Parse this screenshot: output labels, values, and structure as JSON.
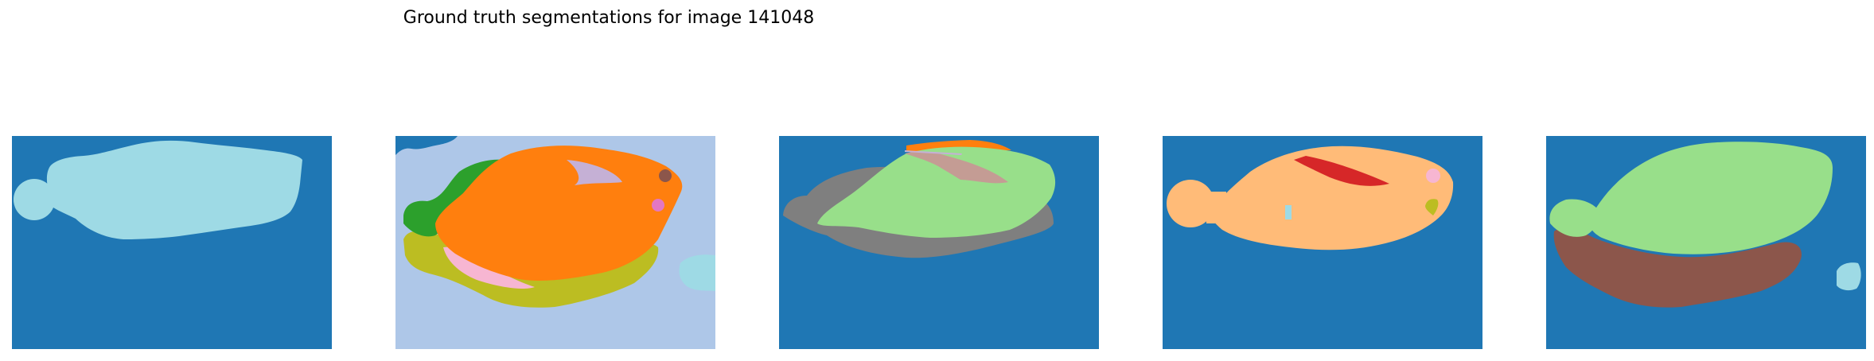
{
  "figure": {
    "title": "Ground truth segmentations for image 141048"
  },
  "panels": [
    {
      "id": 1,
      "background": "#1f77b4",
      "segments": [
        "#9edae5"
      ]
    },
    {
      "id": 2,
      "background": "#aec7e8",
      "segments": [
        "#ff7f0e",
        "#2ca02c",
        "#bcbd22",
        "#f7b6d2",
        "#c5b0d5",
        "#8c564b",
        "#e377c2",
        "#9edae5",
        "#1f77b4"
      ]
    },
    {
      "id": 3,
      "background": "#1f77b4",
      "segments": [
        "#7f7f7f",
        "#98df8a",
        "#ff7f0e",
        "#c49c94"
      ]
    },
    {
      "id": 4,
      "background": "#1f77b4",
      "segments": [
        "#ffbb78",
        "#d62728",
        "#f7b6d2",
        "#bcbd22",
        "#9edae5"
      ]
    },
    {
      "id": 5,
      "background": "#1f77b4",
      "segments": [
        "#8c564b",
        "#98df8a",
        "#9edae5"
      ]
    }
  ]
}
